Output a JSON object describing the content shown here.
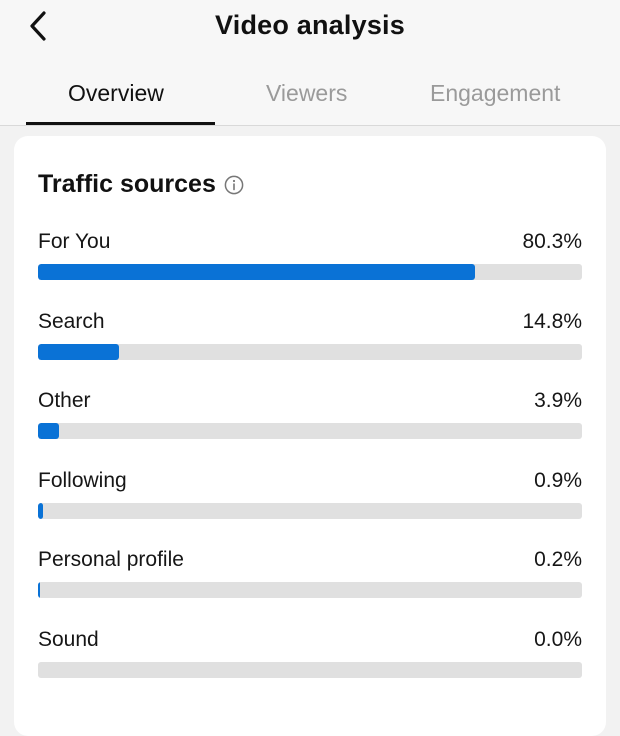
{
  "header": {
    "title": "Video analysis"
  },
  "tabs": [
    {
      "label": "Overview",
      "active": true
    },
    {
      "label": "Viewers",
      "active": false
    },
    {
      "label": "Engagement",
      "active": false
    }
  ],
  "traffic_sources": {
    "title": "Traffic sources",
    "bar_color": "#0a72d6",
    "track_color": "#e0e0e0",
    "items": [
      {
        "label": "For You",
        "value_text": "80.3%",
        "fraction": 0.803
      },
      {
        "label": "Search",
        "value_text": "14.8%",
        "fraction": 0.148
      },
      {
        "label": "Other",
        "value_text": "3.9%",
        "fraction": 0.039
      },
      {
        "label": "Following",
        "value_text": "0.9%",
        "fraction": 0.009
      },
      {
        "label": "Personal profile",
        "value_text": "0.2%",
        "fraction": 0.002
      },
      {
        "label": "Sound",
        "value_text": "0.0%",
        "fraction": 0.0
      }
    ]
  }
}
